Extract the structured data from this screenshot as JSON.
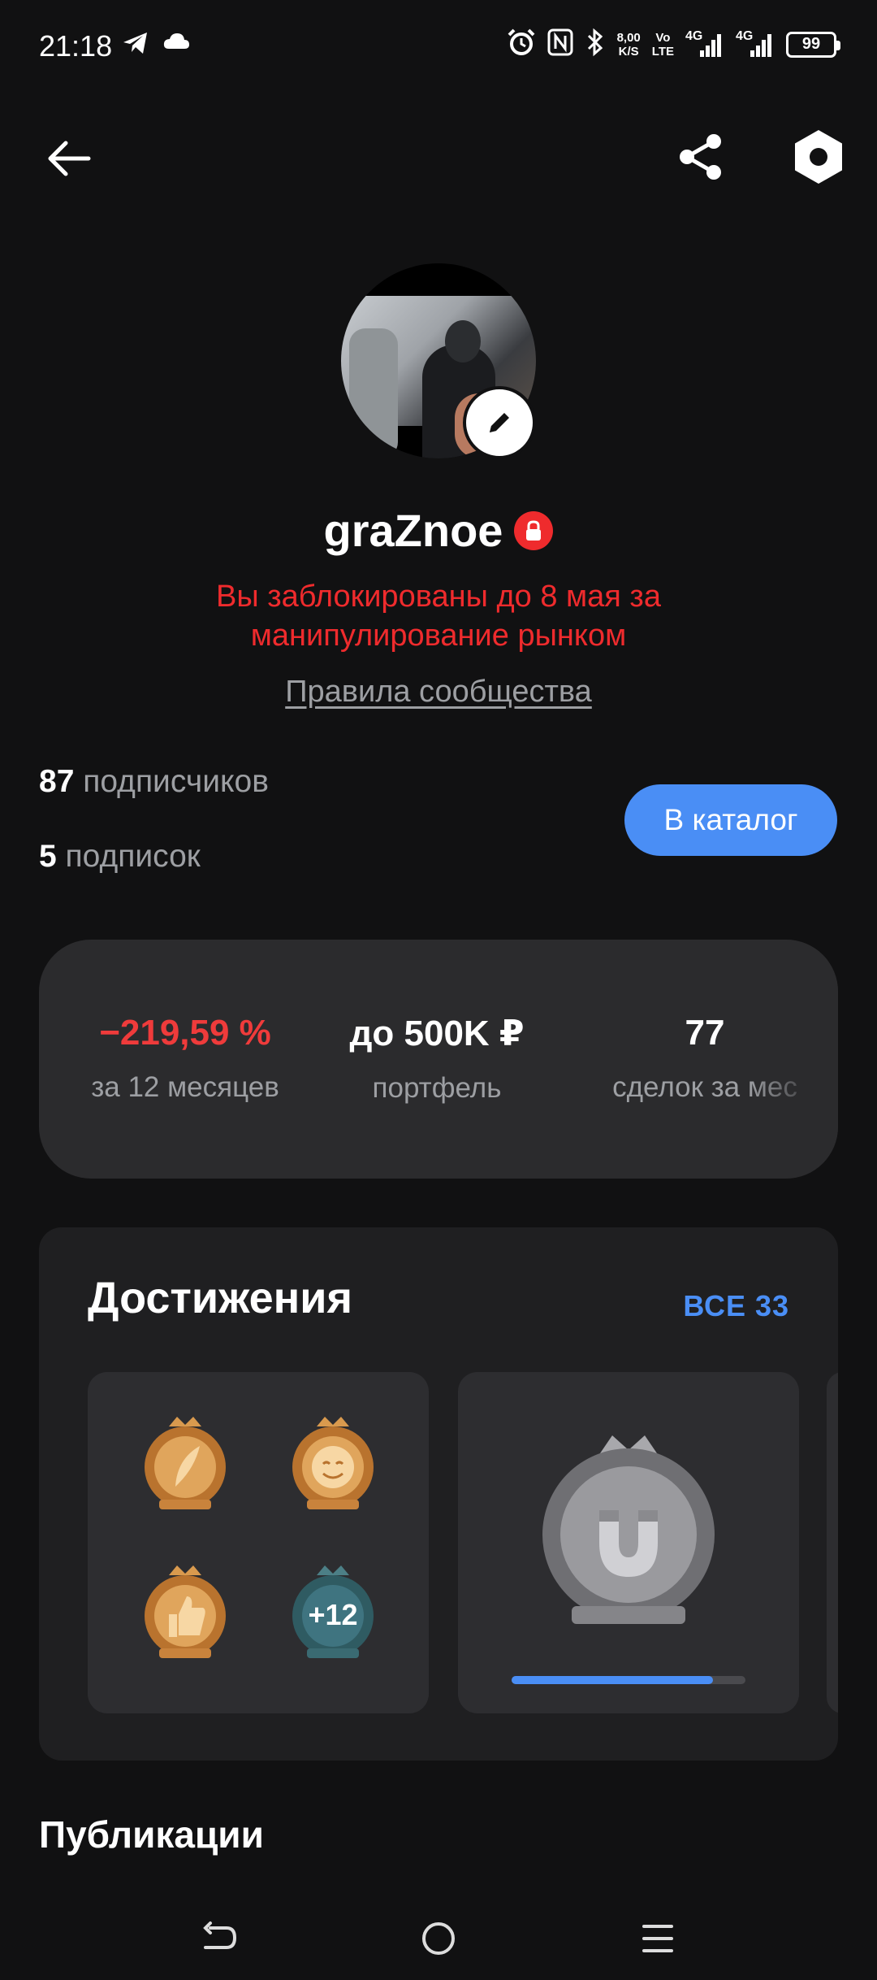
{
  "status_bar": {
    "time": "21:18",
    "left_icons": [
      "telegram-icon",
      "cloud-icon"
    ],
    "right_icons": [
      "alarm-icon",
      "nfc-icon",
      "bluetooth-icon"
    ],
    "net_speed_value": "8,00",
    "net_speed_unit": "K/S",
    "volte_top": "Vo",
    "volte_bottom": "LTE",
    "signal1_label": "4G",
    "signal2_label": "4G",
    "battery": "99"
  },
  "header": {
    "back_icon": "arrow-left-icon",
    "share_icon": "share-icon",
    "settings_icon": "hexagon-settings-icon"
  },
  "profile": {
    "username": "graZnoe",
    "ban_message": "Вы заблокированы до 8 мая за манипулирование рынком",
    "rules_link": "Правила сообщества",
    "followers_count": "87",
    "followers_label": "подписчиков",
    "following_count": "5",
    "following_label": "подписок",
    "catalog_button": "В каталог"
  },
  "stats": [
    {
      "value": "−219,59 %",
      "label": "за 12 месяцев"
    },
    {
      "value": "до 500K ₽",
      "label": "портфель"
    },
    {
      "value": "77",
      "label": "сделок за мес"
    }
  ],
  "achievements": {
    "title": "Достижения",
    "all_label": "ВСЕ 33",
    "extra_count_label": "+12",
    "progress": 0.86
  },
  "publications": {
    "title": "Публикации"
  },
  "colors": {
    "background": "#111112",
    "card": "#2b2b2d",
    "accent_blue": "#4a8ef5",
    "error_red": "#ef2b2d",
    "muted_text": "#9d9fa3"
  }
}
